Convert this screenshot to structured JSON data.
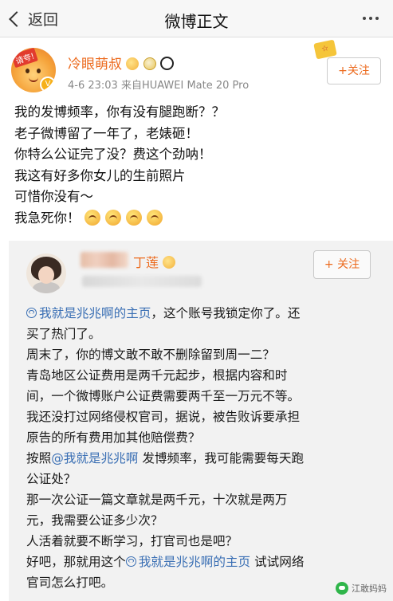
{
  "nav": {
    "back_label": "返回",
    "title": "微博正文"
  },
  "post": {
    "author": "冷眼萌叔",
    "avatar_tag": "请夸!",
    "meta": "4-6 23:03  来自HUAWEI Mate 20 Pro",
    "follow_label": "+关注",
    "lines": [
      "我的发博频率，你有没有腿跑断？？",
      "老子微博留了一年了，老婊砸！",
      "你特么公证完了没？费这个劲呐！",
      "我这有好多你女儿的生前照片",
      "可惜你没有～",
      "我急死你！"
    ]
  },
  "quoted": {
    "author_visible": "丁莲",
    "follow_label": "+ 关注",
    "link_account": "我就是兆兆啊的主页",
    "link_mention": "@我就是兆兆啊",
    "lines": [
      "，这个账号我锁定你了。还",
      "买了热门了。",
      "周末了，你的博文敢不敢不删除留到周一二？",
      "青岛地区公证费用是两千元起步，根据内容和时",
      "间，一个微博账户公证费需要两千至一万元不等。",
      "我还没打过网络侵权官司，据说，被告败诉要承担",
      "原告的所有费用加其他赔偿费？",
      "按照",
      " 发博频率，我可能需要每天跑",
      "公证处？",
      "那一次公证一篇文章就是两千元，十次就是两万",
      "元，我需要公证多少次？",
      "人活着就要不断学习，打官司也是吧？",
      "好吧，那就用这个",
      " 试试网络",
      "官司怎么打吧。"
    ]
  },
  "watermark": {
    "text": "江敢妈妈"
  },
  "colors": {
    "accent": "#ec6a1d",
    "link": "#3a6fb4"
  }
}
